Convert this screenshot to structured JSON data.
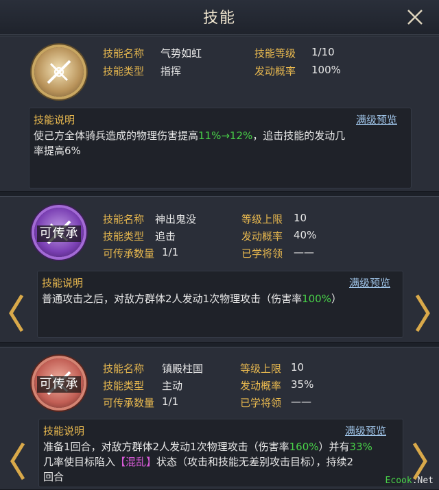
{
  "title": "技能",
  "colors": {
    "label_gold": "#e9b94f",
    "highlight_green": "#48d148",
    "status_pink": "#d85bd8",
    "link_blue": "#9fc4e8"
  },
  "skills": [
    {
      "emblem_color": "gold",
      "emblem_badge": "",
      "fields": [
        {
          "label": "技能名称",
          "value": "气势如虹"
        },
        {
          "label": "技能类型",
          "value": "指挥"
        },
        {
          "label": "技能等级",
          "value": "1/10"
        },
        {
          "label": "发动概率",
          "value": "100%"
        }
      ],
      "desc_header": "技能说明",
      "preview_label": "满级预览",
      "desc": {
        "a": "使己方全体骑兵造成的物理伤害提高",
        "b": "11%→12%",
        "c": "，追击技能的发动几",
        "d": "率提高6%"
      }
    },
    {
      "emblem_color": "purple",
      "emblem_badge": "可传承",
      "fields": [
        {
          "label": "技能名称",
          "value": "神出鬼没"
        },
        {
          "label": "技能类型",
          "value": "追击"
        },
        {
          "label": "可传承数量",
          "value": "1/1"
        },
        {
          "label": "等级上限",
          "value": "10"
        },
        {
          "label": "发动概率",
          "value": "40%"
        },
        {
          "label": "已学将领",
          "value": "——"
        }
      ],
      "desc_header": "技能说明",
      "preview_label": "满级预览",
      "desc": {
        "a": "普通攻击之后，对敌方群体2人发动1次物理攻击（伤害率",
        "b": "100%",
        "c": "）"
      }
    },
    {
      "emblem_color": "red",
      "emblem_badge": "可传承",
      "fields": [
        {
          "label": "技能名称",
          "value": "镇殿柱国"
        },
        {
          "label": "技能类型",
          "value": "主动"
        },
        {
          "label": "可传承数量",
          "value": "1/1"
        },
        {
          "label": "等级上限",
          "value": "10"
        },
        {
          "label": "发动概率",
          "value": "35%"
        },
        {
          "label": "已学将领",
          "value": "——"
        }
      ],
      "desc_header": "技能说明",
      "preview_label": "满级预览",
      "desc": {
        "a": "准备1回合，对敌方群体2人发动1次物理攻击（伤害率",
        "b": "160%",
        "c": "）并有",
        "d": "33%",
        "e": "几率使目标陷入",
        "f": "【混乱】",
        "g": "状态（攻击和技能无差别攻击目标），持续2",
        "h": "回合"
      }
    }
  ],
  "watermark": {
    "a": "Ecook",
    "b": ".Net"
  }
}
